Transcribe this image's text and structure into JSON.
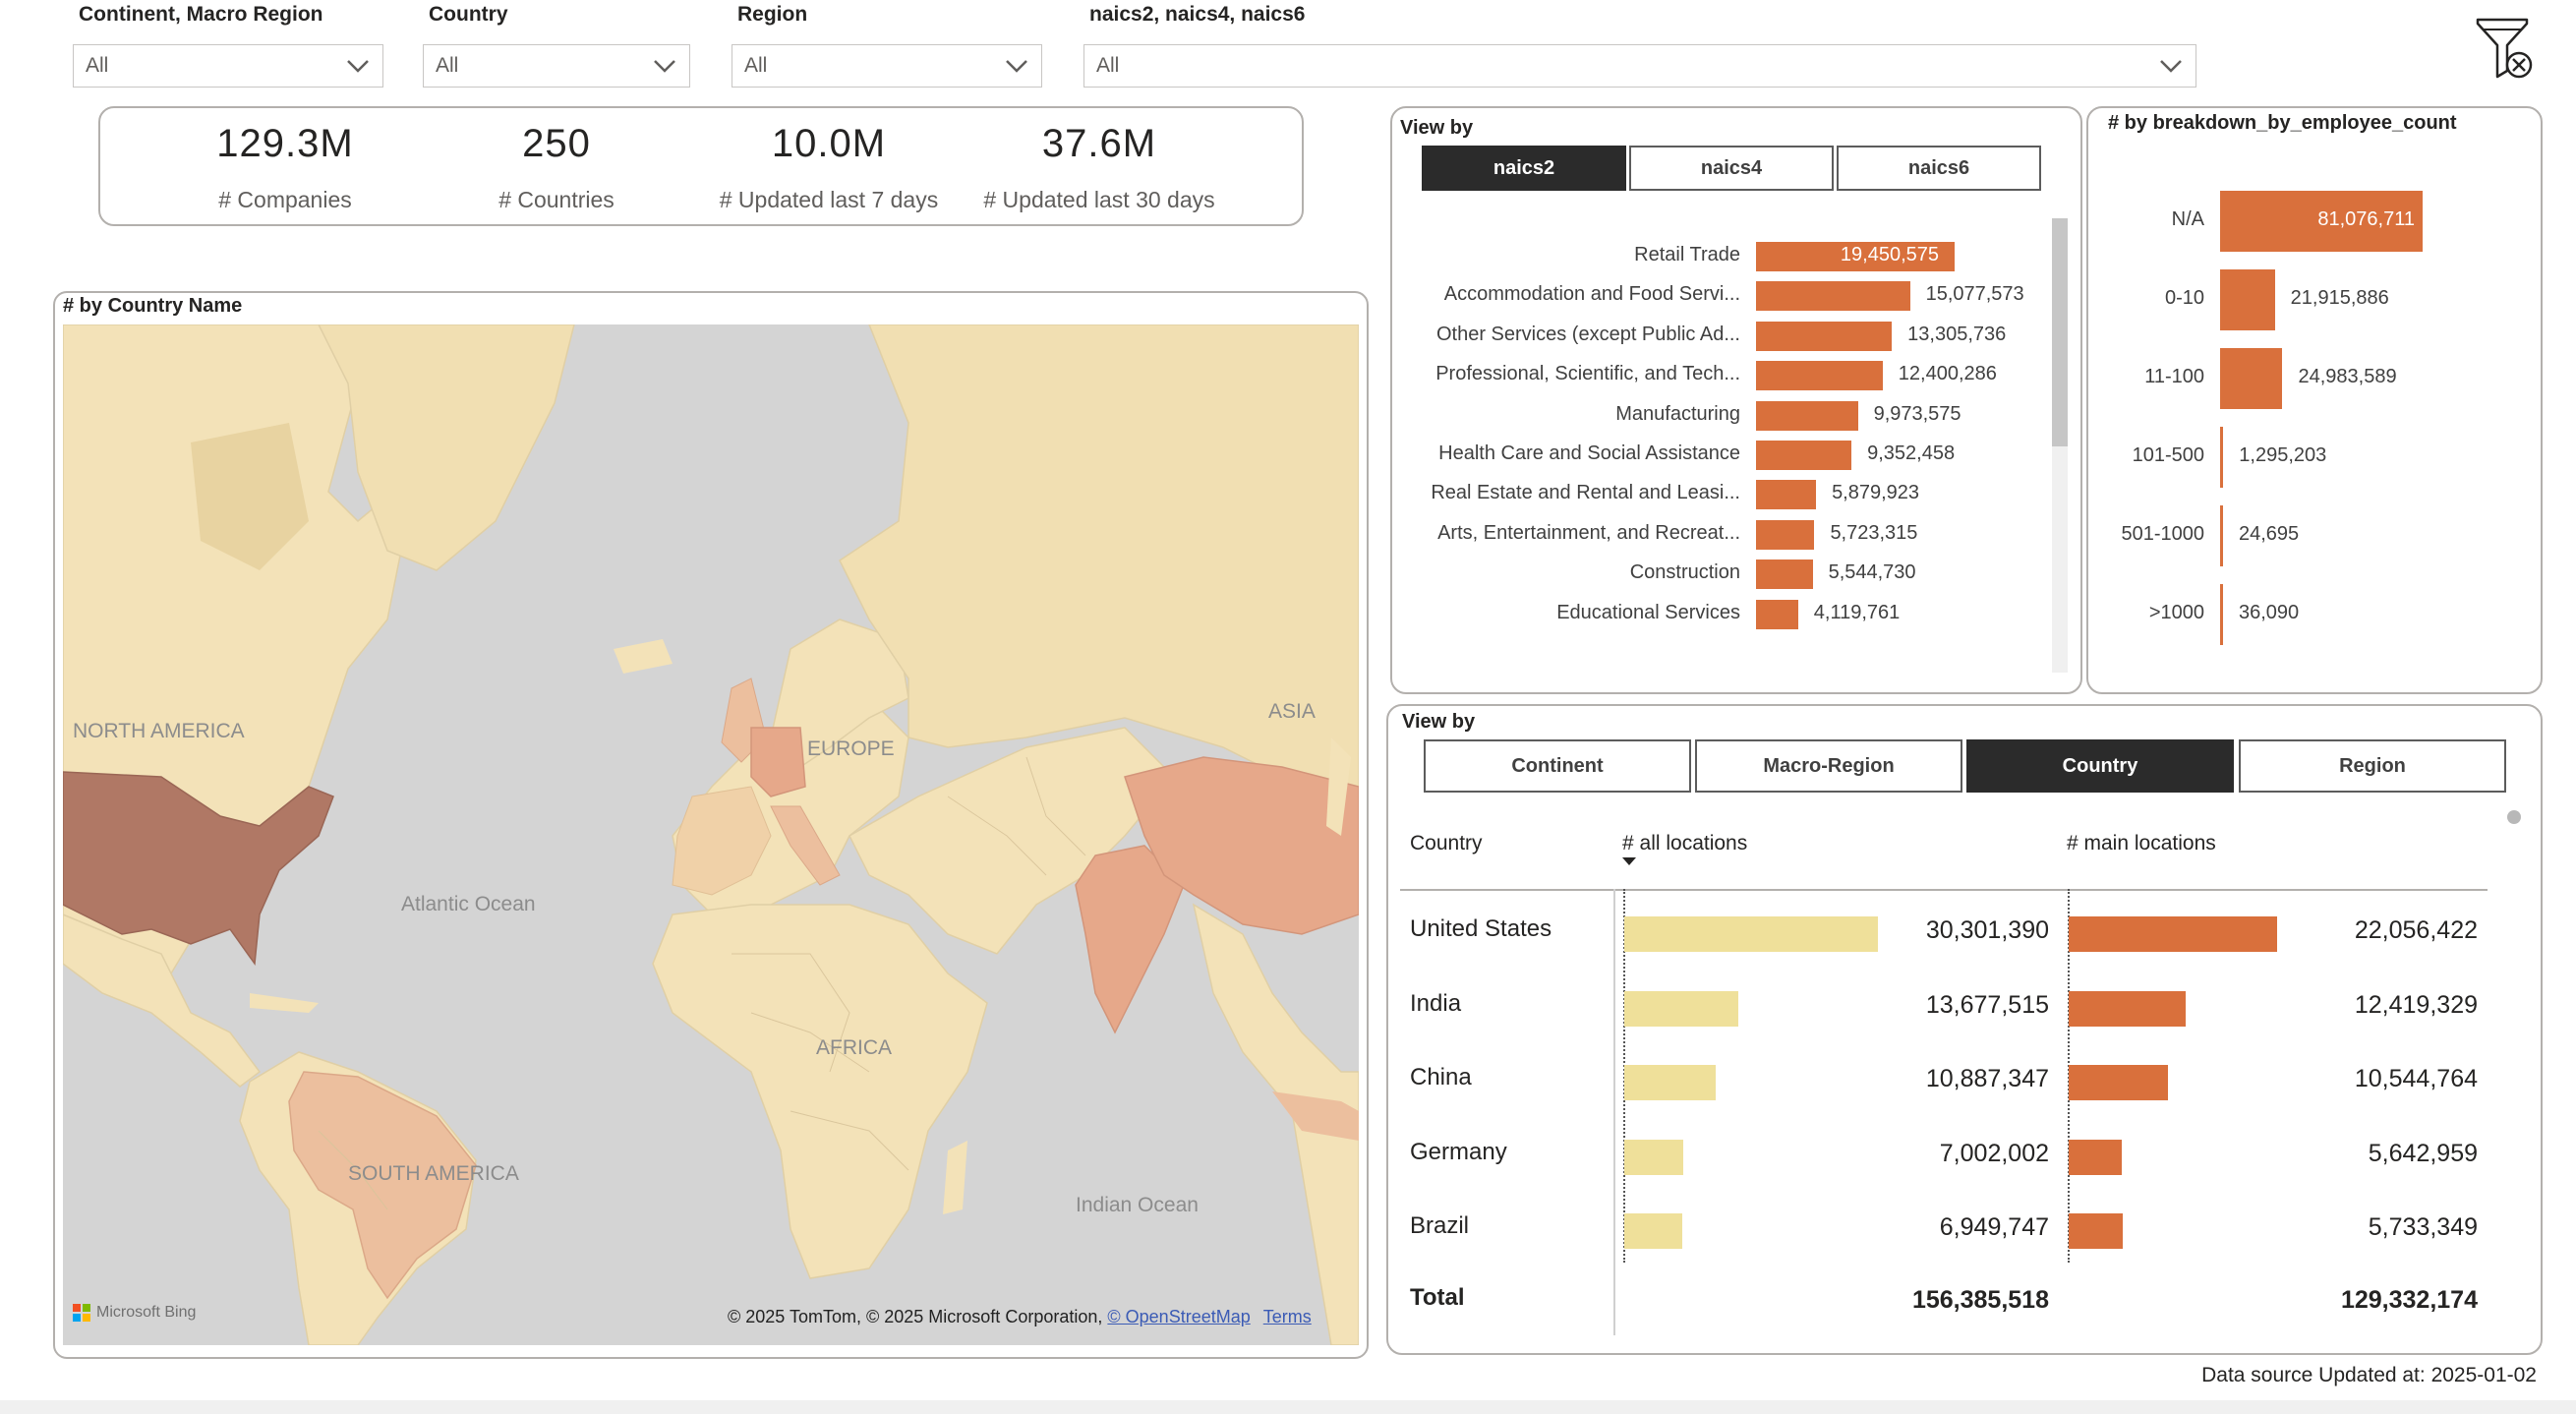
{
  "slicers": [
    {
      "label": "Continent, Macro Region",
      "value": "All"
    },
    {
      "label": "Country",
      "value": "All"
    },
    {
      "label": "Region",
      "value": "All"
    },
    {
      "label": "naics2, naics4, naics6",
      "value": "All"
    }
  ],
  "kpis": [
    {
      "value": "129.3M",
      "label": "# Companies"
    },
    {
      "value": "250",
      "label": "# Countries"
    },
    {
      "value": "10.0M",
      "label": "# Updated last 7 days"
    },
    {
      "value": "37.6M",
      "label": "# Updated last 30 days"
    }
  ],
  "map": {
    "title": "# by Country Name",
    "labels": {
      "north_america": "NORTH AMERICA",
      "europe": "EUROPE",
      "asia": "ASIA",
      "atlantic": "Atlantic Ocean",
      "africa": "AFRICA",
      "south_america": "SOUTH AMERICA",
      "indian": "Indian Ocean"
    },
    "brand": "Microsoft Bing",
    "copyright": "© 2025 TomTom, © 2025 Microsoft Corporation,",
    "osm_link": "© OpenStreetMap",
    "terms_link": "Terms",
    "colors": {
      "water": "#d4d4d4",
      "land": "#f3e2b8",
      "usa": "#b07865",
      "china_india": "#e6a88a",
      "brazil": "#ecbf9e"
    }
  },
  "naics": {
    "title": "View by",
    "tabs": [
      "naics2",
      "naics4",
      "naics6"
    ],
    "active_tab": "naics2",
    "max": 19450575,
    "rows": [
      {
        "label": "Retail Trade",
        "value": 19450575,
        "display": "19,450,575"
      },
      {
        "label": "Accommodation and Food Servi...",
        "value": 15077573,
        "display": "15,077,573"
      },
      {
        "label": "Other Services (except Public Ad...",
        "value": 13305736,
        "display": "13,305,736"
      },
      {
        "label": "Professional, Scientific, and Tech...",
        "value": 12400286,
        "display": "12,400,286"
      },
      {
        "label": "Manufacturing",
        "value": 9973575,
        "display": "9,973,575"
      },
      {
        "label": "Health Care and Social Assistance",
        "value": 9352458,
        "display": "9,352,458"
      },
      {
        "label": "Real Estate and Rental and Leasi...",
        "value": 5879923,
        "display": "5,879,923"
      },
      {
        "label": "Arts, Entertainment, and Recreat...",
        "value": 5723315,
        "display": "5,723,315"
      },
      {
        "label": "Construction",
        "value": 5544730,
        "display": "5,544,730"
      },
      {
        "label": "Educational Services",
        "value": 4119761,
        "display": "4,119,761"
      }
    ]
  },
  "employees": {
    "title": "# by breakdown_by_employee_count",
    "max": 81076711,
    "rows": [
      {
        "label": "N/A",
        "value": 81076711,
        "display": "81,076,711"
      },
      {
        "label": "0-10",
        "value": 21915886,
        "display": "21,915,886"
      },
      {
        "label": "11-100",
        "value": 24983589,
        "display": "24,983,589"
      },
      {
        "label": "101-500",
        "value": 1295203,
        "display": "1,295,203"
      },
      {
        "label": "501-1000",
        "value": 24695,
        "display": "24,695"
      },
      {
        "label": ">1000",
        "value": 36090,
        "display": "36,090"
      }
    ]
  },
  "geo": {
    "title": "View by",
    "tabs": [
      "Continent",
      "Macro-Region",
      "Country",
      "Region"
    ],
    "active_tab": "Country",
    "headers": {
      "country": "Country",
      "all": "# all locations",
      "main": "# main locations"
    },
    "max_all": 30301390,
    "max_main": 22056422,
    "rows": [
      {
        "country": "United States",
        "all": 30301390,
        "all_display": "30,301,390",
        "main": 22056422,
        "main_display": "22,056,422"
      },
      {
        "country": "India",
        "all": 13677515,
        "all_display": "13,677,515",
        "main": 12419329,
        "main_display": "12,419,329"
      },
      {
        "country": "China",
        "all": 10887347,
        "all_display": "10,887,347",
        "main": 10544764,
        "main_display": "10,544,764"
      },
      {
        "country": "Germany",
        "all": 7002002,
        "all_display": "7,002,002",
        "main": 5642959,
        "main_display": "5,642,959"
      },
      {
        "country": "Brazil",
        "all": 6949747,
        "all_display": "6,949,747",
        "main": 5733349,
        "main_display": "5,733,349"
      }
    ],
    "total": {
      "label": "Total",
      "all": "156,385,518",
      "main": "129,332,174"
    },
    "colors": {
      "all_bar": "#efe09a",
      "main_bar": "#d9703c"
    }
  },
  "footer": {
    "data_source": "Data source Updated at: 2025-01-02"
  }
}
